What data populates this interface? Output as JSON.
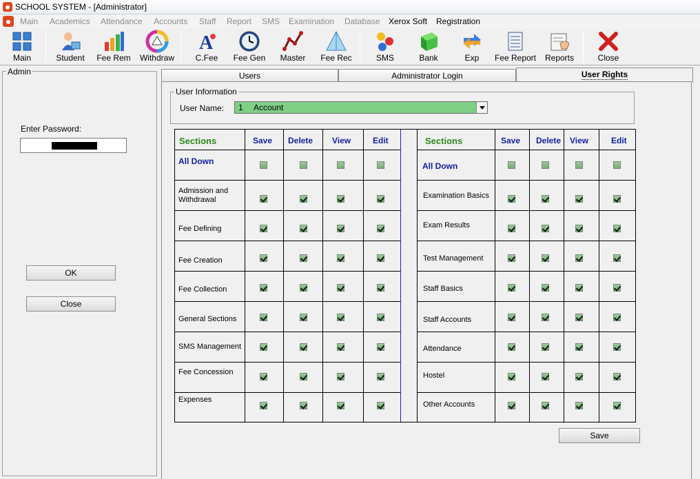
{
  "window": {
    "title": "SCHOOL SYSTEM - [Administrator]"
  },
  "menu": {
    "items": [
      {
        "label": "Main",
        "active": false
      },
      {
        "label": "Academics",
        "active": false
      },
      {
        "label": "Attendance",
        "active": false
      },
      {
        "label": "Accounts",
        "active": false
      },
      {
        "label": "Staff",
        "active": false
      },
      {
        "label": "Report",
        "active": false
      },
      {
        "label": "SMS",
        "active": false
      },
      {
        "label": "Examination",
        "active": false
      },
      {
        "label": "Database",
        "active": false
      },
      {
        "label": "Xerox Soft",
        "active": true
      },
      {
        "label": "Registration",
        "active": true
      }
    ]
  },
  "toolbar": {
    "items": [
      {
        "label": "Main",
        "icon": "main-grid-icon"
      },
      {
        "label": "Student",
        "icon": "student-icon"
      },
      {
        "label": "Fee Rem",
        "icon": "bar-chart-icon"
      },
      {
        "label": "Withdraw",
        "icon": "color-wheel-icon"
      },
      {
        "label": "C.Fee",
        "icon": "font-a-icon"
      },
      {
        "label": "Fee Gen",
        "icon": "clock-icon"
      },
      {
        "label": "Master",
        "icon": "line-graph-icon"
      },
      {
        "label": "Fee Rec",
        "icon": "pyramid-icon"
      },
      {
        "label": "SMS",
        "icon": "balls-icon"
      },
      {
        "label": "Bank",
        "icon": "green-box-icon"
      },
      {
        "label": "Exp",
        "icon": "exchange-arrows-icon"
      },
      {
        "label": "Fee Report",
        "icon": "scroll-icon"
      },
      {
        "label": "Reports",
        "icon": "report-hand-icon"
      },
      {
        "label": "Close",
        "icon": "close-x-icon"
      }
    ]
  },
  "admin": {
    "group_title": "Admin",
    "password_label": "Enter Password:",
    "ok_label": "OK",
    "close_label": "Close"
  },
  "tabs": [
    {
      "label": "Users",
      "selected": false
    },
    {
      "label": "Administrator Login",
      "selected": false
    },
    {
      "label": "User Rights",
      "selected": true
    }
  ],
  "user_info": {
    "group_title": "User Information",
    "name_label": "User Name:",
    "selected_id": "1",
    "selected_name": "Account"
  },
  "rights": {
    "headers": [
      "Sections",
      "Save",
      "Delete",
      "View",
      "Edit"
    ],
    "all_down_label": "All Down",
    "left_sections": [
      "Admission and Withdrawal",
      "Fee Defining",
      "Fee Creation",
      "Fee Collection",
      "General Sections",
      "SMS Management",
      "Fee Concession",
      "Expenses"
    ],
    "right_sections": [
      "Examination Basics",
      "Exam Results",
      "Test Management",
      "Staff Basics",
      "Staff Accounts",
      "Attendance",
      "Hostel",
      "Other Accounts"
    ],
    "all_down_checked": false,
    "sections_checked": true
  },
  "save_label": "Save",
  "colors": {
    "section_header": "#2a8a1a",
    "column_header": "#0f1fa0",
    "combo_highlight": "#7fcf86"
  }
}
